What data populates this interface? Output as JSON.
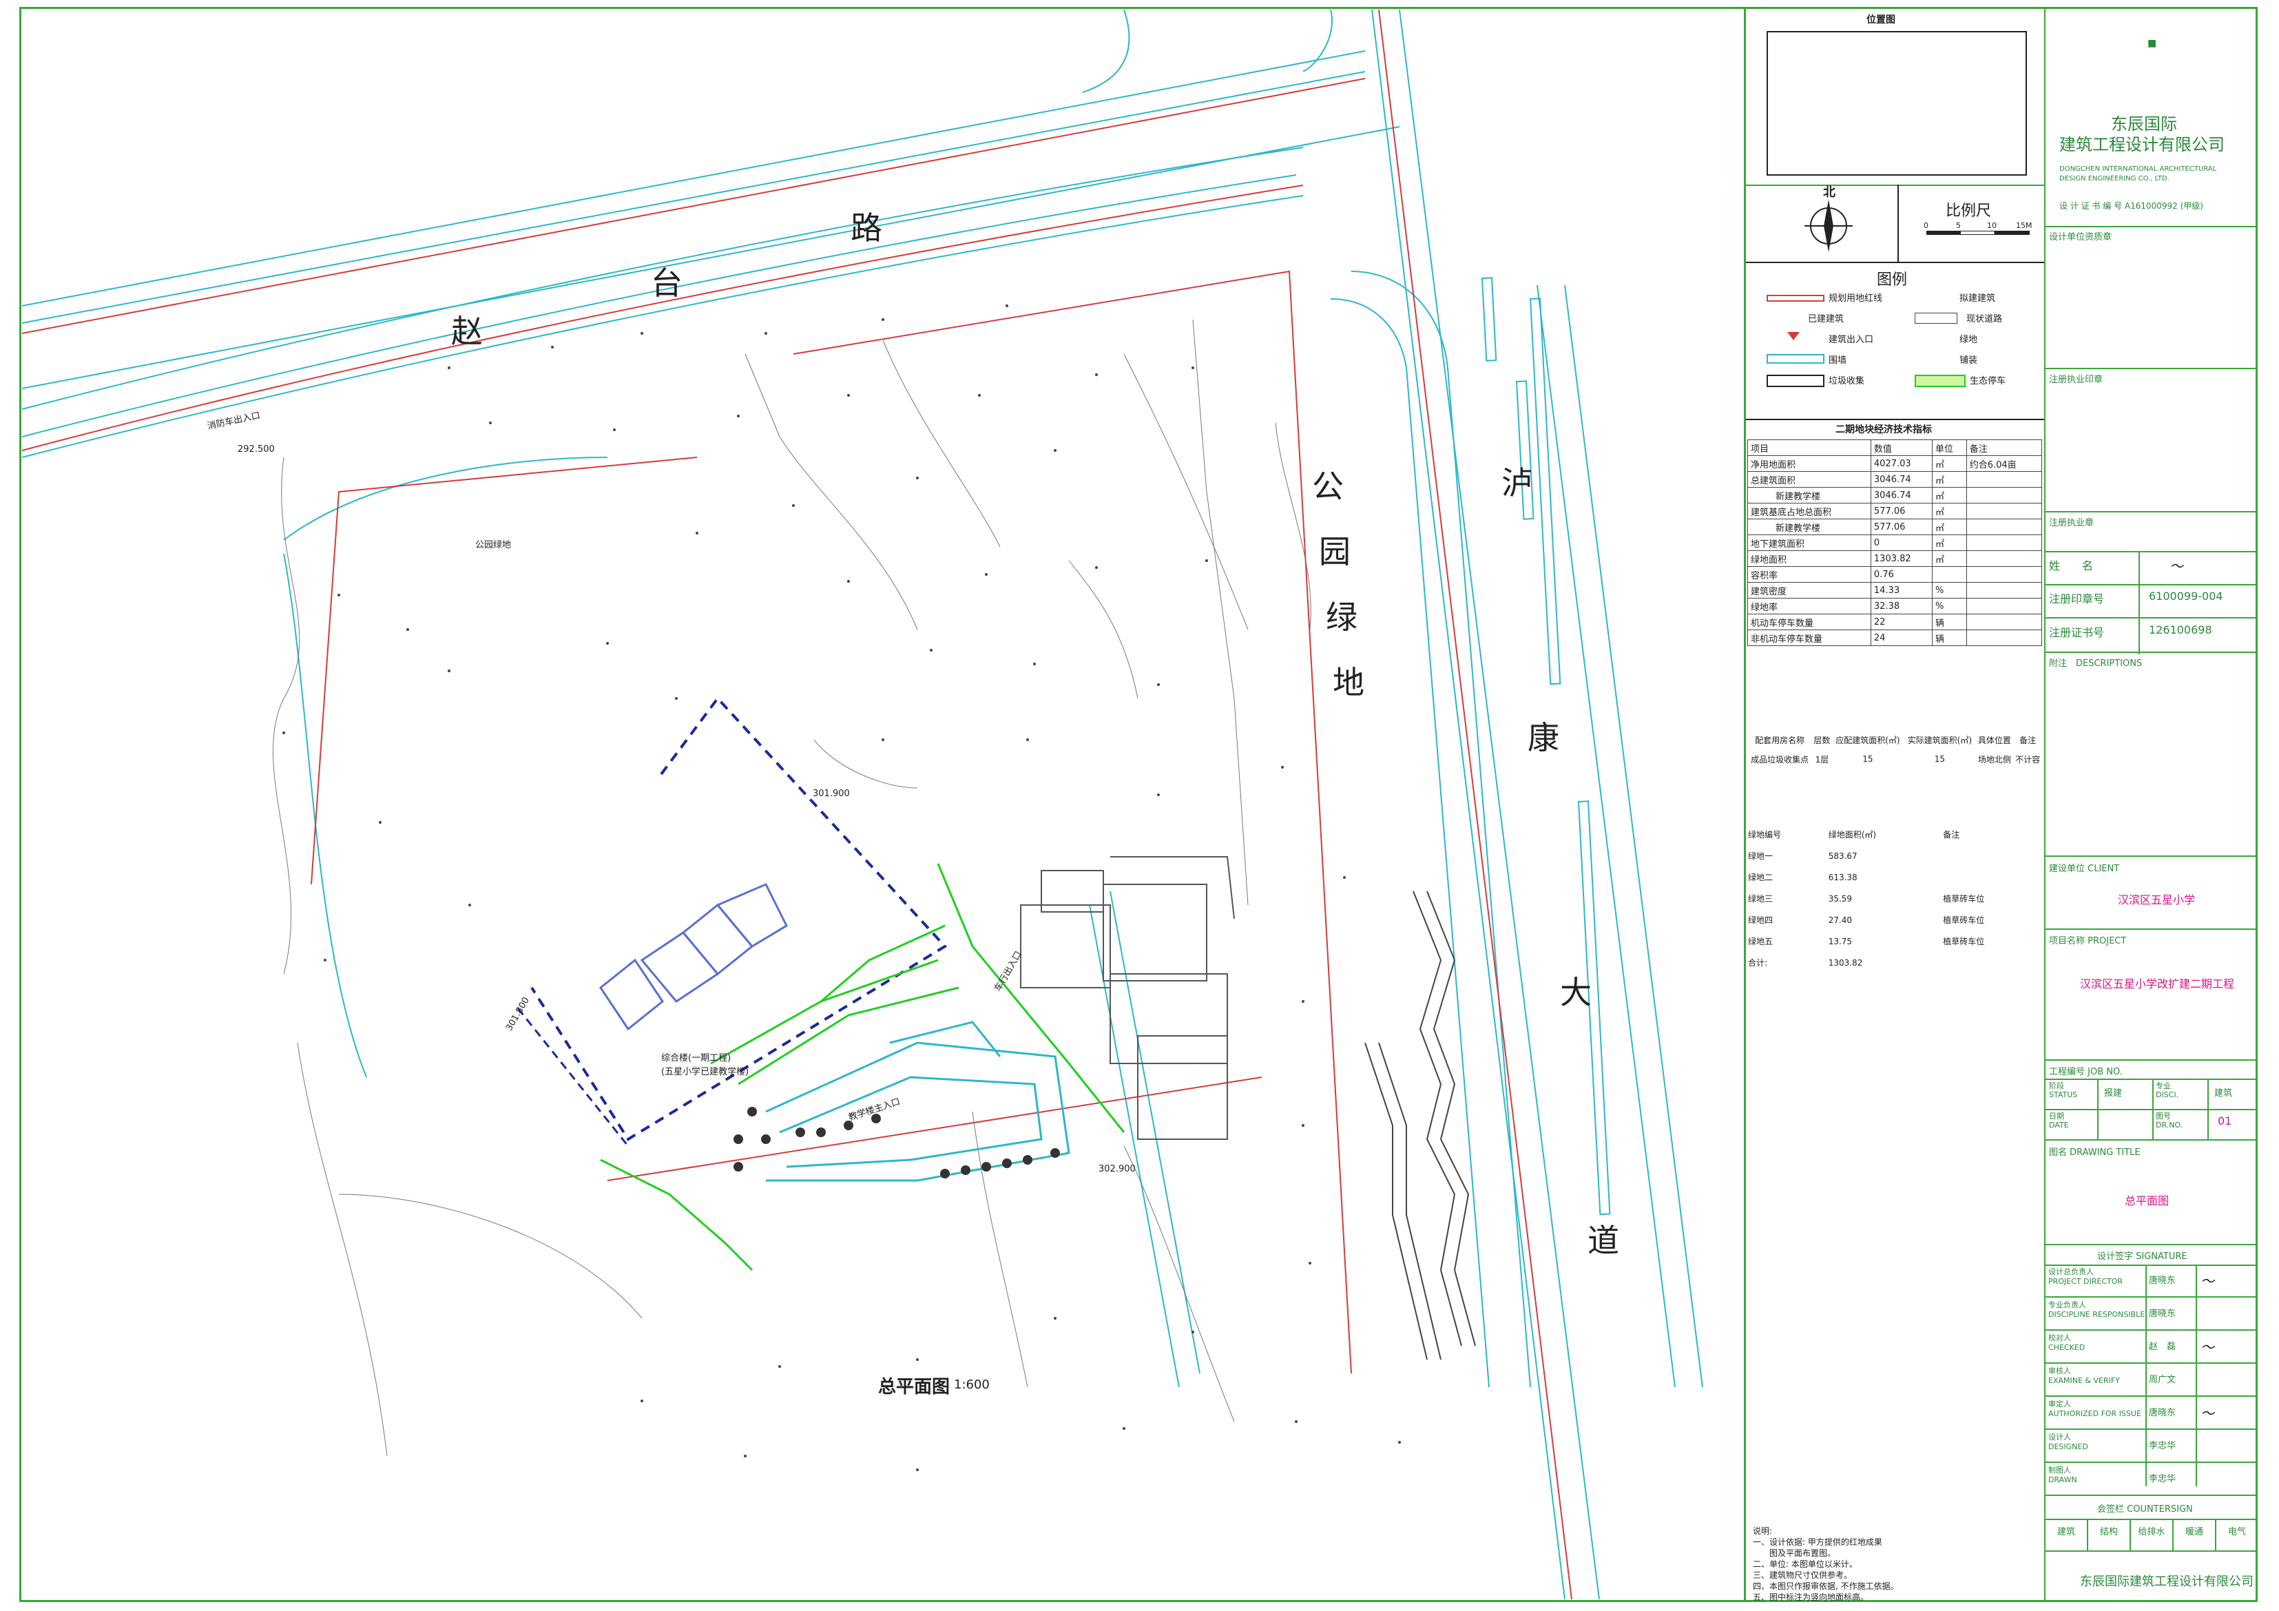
{
  "road_labels": {
    "zhaotai": [
      "赵",
      "台",
      "路"
    ],
    "lukang": [
      "泸",
      "康",
      "大",
      "道"
    ],
    "park": [
      "公",
      "园",
      "绿",
      "地"
    ]
  },
  "plan_title": "总平面图",
  "plan_scale": "1:600",
  "north_label": "北",
  "scale_bar": {
    "label": "比例尺",
    "ticks": [
      "0",
      "5",
      "10",
      "15M"
    ]
  },
  "location_title": "位置图",
  "legend": {
    "title": "图例",
    "items": [
      {
        "label": "规划用地红线",
        "right": "拟建建筑"
      },
      {
        "label": "已建建筑",
        "right": "现状道路"
      },
      {
        "label": "建筑出入口",
        "right": "绿地"
      },
      {
        "label": "围墙",
        "right": "铺装"
      },
      {
        "label": "垃圾收集",
        "right": "生态停车"
      }
    ]
  },
  "indicators": {
    "title": "二期地块经济技术指标",
    "header": [
      "项目",
      "数值",
      "单位",
      "备注"
    ],
    "rows": [
      [
        "净用地面积",
        "4027.03",
        "㎡",
        "约合6.04亩"
      ],
      [
        "总建筑面积",
        "3046.74",
        "㎡",
        ""
      ],
      [
        "新建教学楼",
        "3046.74",
        "㎡",
        ""
      ],
      [
        "建筑基底占地总面积",
        "577.06",
        "㎡",
        ""
      ],
      [
        "新建教学楼",
        "577.06",
        "㎡",
        ""
      ],
      [
        "地下建筑面积",
        "0",
        "㎡",
        ""
      ],
      [
        "绿地面积",
        "1303.82",
        "㎡",
        ""
      ],
      [
        "容积率",
        "0.76",
        "",
        ""
      ],
      [
        "建筑密度",
        "14.33",
        "%",
        ""
      ],
      [
        "绿地率",
        "32.38",
        "%",
        ""
      ],
      [
        "机动车停车数量",
        "22",
        "辆",
        ""
      ],
      [
        "非机动车停车数量",
        "24",
        "辆",
        ""
      ]
    ]
  },
  "facility": {
    "header": [
      "配套用房名称",
      "层数",
      "应配建筑面积(㎡)",
      "实际建筑面积(㎡)",
      "具体位置",
      "备注"
    ],
    "row": [
      "成品垃圾收集点",
      "1层",
      "15",
      "15",
      "场地北侧",
      "不计容"
    ]
  },
  "greens": {
    "header": [
      "绿地编号",
      "绿地面积(㎡)",
      "备注"
    ],
    "rows": [
      [
        "绿地一",
        "583.67",
        ""
      ],
      [
        "绿地二",
        "613.38",
        ""
      ],
      [
        "绿地三",
        "35.59",
        "植草砖车位"
      ],
      [
        "绿地四",
        "27.40",
        "植草砖车位"
      ],
      [
        "绿地五",
        "13.75",
        "植草砖车位"
      ],
      [
        "合计:",
        "1303.82",
        ""
      ]
    ]
  },
  "notes": {
    "title": "说明:",
    "items": [
      "一、设计依据: 甲方提供的红地成果",
      "　　图及平面布置图。",
      "二、单位: 本图单位以米计。",
      "三、建筑物尺寸仅供参考。",
      "四、本图只作报审依据, 不作施工依据。",
      "五、图中标注为竖向地面标高。"
    ]
  },
  "company": {
    "name_cn_1": "东辰国际",
    "name_cn_2": "建筑工程设计有限公司",
    "name_en_1": "DONGCHEN INTERNATIONAL ARCHITECTURAL",
    "name_en_2": "DESIGN ENGINEERING CO., LTD.",
    "cert": "设 计 证 书 编 号 A161000992 (甲级)",
    "footer": "东辰国际建筑工程设计有限公司"
  },
  "title_block": {
    "qual_seal": "设计单位资质章",
    "reg_seal": "注册执业印章",
    "reg_cert": "注册执业章",
    "name_label": "姓　　名",
    "seal_no_label": "注册印章号",
    "seal_no": "6100099-004",
    "cert_no_label": "注册证书号",
    "cert_no": "126100698",
    "desc": "附注　DESCRIPTIONS",
    "client_label": "建设单位 CLIENT",
    "client": "汉滨区五星小学",
    "project_label": "项目名称 PROJECT",
    "project": "汉滨区五星小学改扩建二期工程",
    "job_label": "工程编号 JOB NO.",
    "status_label": "阶段\nSTATUS",
    "status": "报建",
    "disc_label": "专业\nDISCI.",
    "disc": "建筑",
    "date_label": "日期\nDATE",
    "drno_label": "图号\nDR.NO.",
    "drno": "01",
    "drawing_title_label": "图名 DRAWING TITLE",
    "drawing_title": "总平面图",
    "sign_title": "设计签字 SIGNATURE",
    "signatures": [
      [
        "设计总负责人\nPROJECT DIRECTOR",
        "唐晓东"
      ],
      [
        "专业负责人\nDISCIPLINE RESPONSIBLE",
        "唐晓东"
      ],
      [
        "校对人\nCHECKED",
        "赵　磊"
      ],
      [
        "审核人\nEXAMINE & VERIFY",
        "周广文"
      ],
      [
        "审定人\nAUTHORIZED FOR ISSUE",
        "唐晓东"
      ],
      [
        "设计人\nDESIGNED",
        "李忠华"
      ],
      [
        "制图人\nDRAWN",
        "李忠华"
      ]
    ],
    "counter_title": "会签栏 COUNTERSIGN",
    "counter": [
      "建筑",
      "结构",
      "给排水",
      "暖通",
      "电气"
    ]
  },
  "plan_labels": {
    "bldg_name": "综合楼(一期工程)",
    "bldg_sub": "(五星小学已建教学楼)",
    "school_gate": "教学楼主入口",
    "east_gate": "车行出入口",
    "north_gate": "消防车出入口",
    "park_green": "公园绿地",
    "road_elev_1": "292.500",
    "road_elev_2": "301.900",
    "road_elev_3": "301.800",
    "road_elev_4": "302.900"
  },
  "colors": {
    "frame": "#3aa63a",
    "red_line": "#d63a3a",
    "cyan": "#2bb8c8",
    "green": "#1fd01f",
    "blue": "#1a2a9a",
    "magenta": "#d4148a"
  }
}
